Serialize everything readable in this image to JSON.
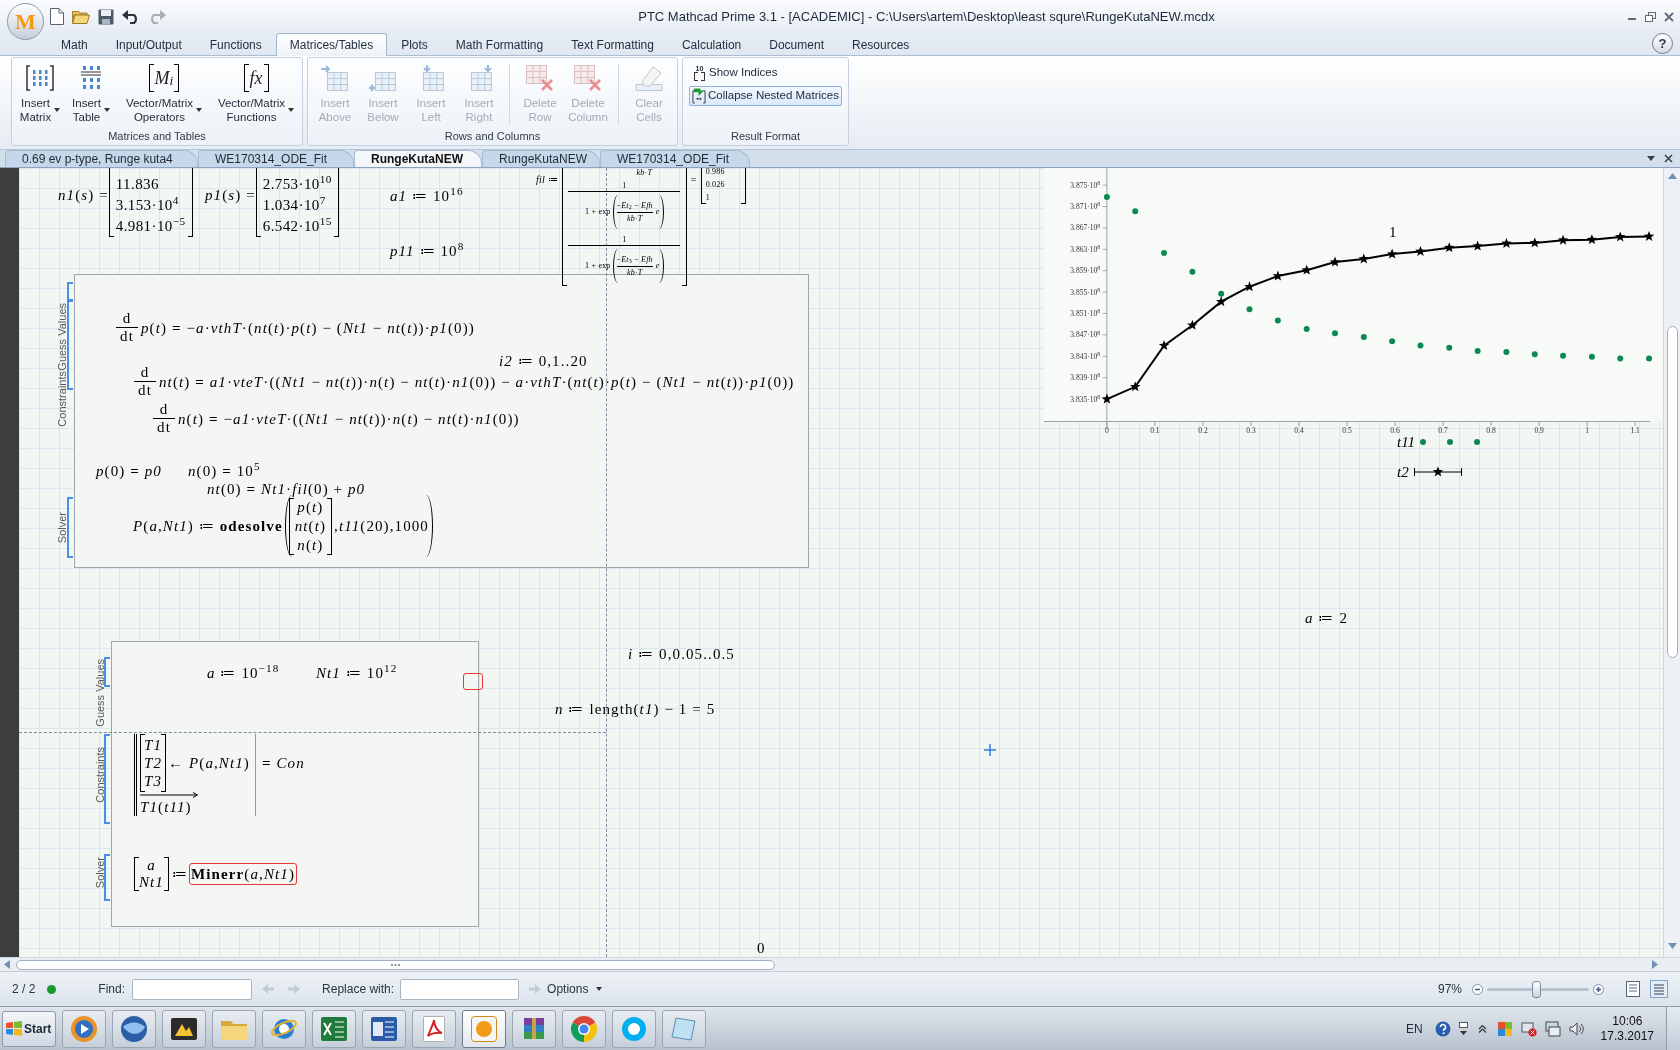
{
  "window": {
    "logo": "M",
    "title": "PTC Mathcad Prime 3.1 - [ACADEMIC] - C:\\Users\\artem\\Desktop\\least squre\\RungeKutaNEW.mcdx"
  },
  "ribbon": {
    "tabs": [
      {
        "label": "Math",
        "selected": false
      },
      {
        "label": "Input/Output",
        "selected": false
      },
      {
        "label": "Functions",
        "selected": false
      },
      {
        "label": "Matrices/Tables",
        "selected": true
      },
      {
        "label": "Plots",
        "selected": false
      },
      {
        "label": "Math Formatting",
        "selected": false
      },
      {
        "label": "Text Formatting",
        "selected": false
      },
      {
        "label": "Calculation",
        "selected": false
      },
      {
        "label": "Document",
        "selected": false
      },
      {
        "label": "Resources",
        "selected": false
      }
    ],
    "help": "?",
    "groups": [
      {
        "title": "Matrices and Tables",
        "sections": [
          [
            {
              "lines": [
                "Insert",
                "Matrix"
              ],
              "dropdown": true,
              "disabled": false
            },
            {
              "lines": [
                "Insert",
                "Table"
              ],
              "dropdown": true,
              "disabled": false
            },
            {
              "lines": [
                "Vector/Matrix",
                "Operators"
              ],
              "glyph": "M$_{i}$",
              "dropdown": true,
              "disabled": false
            },
            {
              "lines": [
                "Vector/Matrix",
                "Functions"
              ],
              "glyph": "fx",
              "dropdown": true,
              "disabled": false
            }
          ]
        ]
      },
      {
        "title": "Rows and Columns",
        "sections": [
          [
            {
              "lines": [
                "Insert",
                "Above"
              ],
              "dropdown": false,
              "disabled": true
            },
            {
              "lines": [
                "Insert",
                "Below"
              ],
              "dropdown": false,
              "disabled": true
            },
            {
              "lines": [
                "Insert",
                "Left"
              ],
              "dropdown": false,
              "disabled": true
            },
            {
              "lines": [
                "Insert",
                "Right"
              ],
              "dropdown": false,
              "disabled": true
            }
          ],
          [
            {
              "lines": [
                "Delete",
                "Row"
              ],
              "dropdown": false,
              "disabled": true
            },
            {
              "lines": [
                "Delete",
                "Column"
              ],
              "dropdown": false,
              "disabled": true
            }
          ],
          [
            {
              "lines": [
                "Clear",
                "Cells"
              ],
              "dropdown": false,
              "disabled": true
            }
          ]
        ]
      },
      {
        "title": "Result Format",
        "toggles": [
          {
            "glyph": "10",
            "label": "Show Indices",
            "selected": false
          },
          {
            "label": "Collapse Nested Matrices",
            "selected": true
          }
        ]
      }
    ]
  },
  "document_tabs": [
    {
      "label": "0.69 ev p-type, Runge kuta4",
      "selected": false
    },
    {
      "label": "WE170314_ODE_Fit",
      "selected": false
    },
    {
      "label": "RungeKutaNEW",
      "selected": true
    },
    {
      "label": "RungeKutaNEW",
      "selected": false
    },
    {
      "label": "WE170314_ODE_Fit",
      "selected": false
    }
  ],
  "worksheet": {
    "regions": [
      {
        "kind": "matrix",
        "lhs": "*n1*(*s*) =",
        "rows": [
          "11.836",
          "3.153·10$^{4}$",
          "4.981·10$^{−5}$"
        ]
      },
      {
        "kind": "matrix",
        "lhs": "*p1*(*s*) =",
        "rows": [
          "2.753·10$^{10}$",
          "1.034·10$^{7}$",
          "6.542·10$^{15}$"
        ]
      },
      {
        "kind": "expr",
        "text": "*a1* ≔ 10$^{16}$"
      },
      {
        "kind": "expr",
        "text": "*p11* ≔ 10$^{8}$"
      },
      {
        "kind": "fraction_matrix",
        "lhs": "*fil* ≔",
        "cut_row": "*kb*·*T*",
        "rows": [
          {
            "numerator": "1",
            "exp": "1 + exp",
            "exp_numerator": "−*Et*$_{2}$ − *Efh*",
            "exp_denominator": "*kb*·*T*",
            "tail": "*e*"
          },
          {
            "numerator": "1",
            "exp": "1 + exp",
            "exp_numerator": "−*Et*$_{3}$ − *Efh*",
            "exp_denominator": "*kb*·*T*",
            "tail": "*e*"
          }
        ],
        "equals": "=",
        "result": [
          "0.986",
          "0.026",
          "1"
        ]
      },
      {
        "kind": "derivative",
        "operator": "d",
        "by": "dt",
        "text": "*p*(*t*) **=** −*a*·*vthT*·(*nt*(*t*)·*p*(*t*) − (*Nt1* − *nt*(*t*))·*p1*(0))"
      },
      {
        "kind": "expr",
        "text": "*i2* ≔ 0,1..20"
      },
      {
        "kind": "derivative",
        "operator": "d",
        "by": "dt",
        "text": "*nt*(*t*) **=** *a1*·*vteT*·((*Nt1* − *nt*(*t*))·*n*(*t*) − *nt*(*t*)·*n1*(0)) − *a*·*vthT*·(*nt*(*t*)·*p*(*t*) − (*Nt1* − *nt*(*t*))·*p1*(0))"
      },
      {
        "kind": "derivative",
        "operator": "d",
        "by": "dt",
        "text": "*n*(*t*) **=** −*a1*·*vteT*·((*Nt1* − *nt*(*t*))·*n*(*t*) − *nt*(*t*)·*n1*(0))"
      },
      {
        "kind": "expr",
        "text": "*p*(0) **=** *p0*"
      },
      {
        "kind": "expr",
        "text": "*n*(0) **=** 10$^{5}$"
      },
      {
        "kind": "expr",
        "text": "*nt*(0) **=** *Nt1*·*fil*(0) + *p0*"
      },
      {
        "kind": "call",
        "lhs": "*P*(*a*,*Nt1*) ≔ **odesolve**",
        "rows": [
          "*p*(*t*)",
          "*nt*(*t*)",
          "*n*(*t*)"
        ],
        "rest": ",*t11*(20),1000"
      },
      {
        "kind": "expr",
        "text": "*a* ≔ 2"
      },
      {
        "kind": "expr",
        "text": "*i* ≔ 0,0.05..0.5"
      },
      {
        "kind": "expr",
        "text": "*n* ≔ length(*t1*) − 1 = 5"
      },
      {
        "kind": "expr",
        "text": "0"
      },
      {
        "kind": "expr",
        "text": "*a* ≔ 10$^{−18}$"
      },
      {
        "kind": "expr",
        "text": "*Nt1* ≔ 10$^{12}$"
      },
      {
        "kind": "placeholder"
      },
      {
        "kind": "program",
        "rows": [
          "*T1*",
          "*T2*",
          "*T3*"
        ],
        "assign": "← *P*(*a*,*Nt1*)",
        "last": "*T1*(*t11*)",
        "result": "**=** *Con*"
      },
      {
        "kind": "solve",
        "rows": [
          "*a*",
          "*Nt1*"
        ],
        "assign": "≔",
        "call": "**Minerr**(*a*,*Nt1*)",
        "error": true
      }
    ],
    "solve_blocks": [
      {
        "labels": [
          "Guess Values",
          "Constraints",
          "Solver"
        ]
      },
      {
        "labels": [
          "Guess Values",
          "Constraints",
          "Solver"
        ]
      }
    ],
    "plot": {
      "chart_data": {
        "type": "line",
        "x": [
          0,
          0.059,
          0.119,
          0.178,
          0.238,
          0.297,
          0.356,
          0.416,
          0.475,
          0.535,
          0.594,
          0.653,
          0.713,
          0.772,
          0.832,
          0.891,
          0.95,
          1.01,
          1.069,
          1.129
        ],
        "series": [
          {
            "name": "t11",
            "color": "#0a8a50",
            "type": "scatter",
            "marker": "circle",
            "values": [
              387280000,
              387010000,
              386230000,
              385880000,
              385470000,
              385180000,
              384970000,
              384810000,
              384730000,
              384660000,
              384580000,
              384500000,
              384460000,
              384400000,
              384380000,
              384340000,
              384310000,
              384290000,
              384260000,
              384260000
            ]
          },
          {
            "name": "t2",
            "color": "#000000",
            "marker": "star",
            "values": [
              383500000,
              383730000,
              384500000,
              384880000,
              385320000,
              385600000,
              385800000,
              385910000,
              386060000,
              386120000,
              386210000,
              386260000,
              386330000,
              386360000,
              386410000,
              386420000,
              386470000,
              386480000,
              386530000,
              386540000
            ]
          }
        ],
        "xlim": [
          -0.131,
          1.131
        ],
        "ylim": [
          383090000,
          387820000
        ],
        "xticks": [
          0,
          0.1,
          0.2,
          0.3,
          0.4,
          0.5,
          0.6,
          0.7,
          0.8,
          0.9,
          1,
          1.1
        ],
        "yticks": [
          {
            "value": 383500000,
            "label": "3.835·10$^{8}$"
          },
          {
            "value": 383900000,
            "label": "3.839·10$^{8}$"
          },
          {
            "value": 384300000,
            "label": "3.843·10$^{8}$"
          },
          {
            "value": 384700000,
            "label": "3.847·10$^{8}$"
          },
          {
            "value": 385100000,
            "label": "3.851·10$^{8}$"
          },
          {
            "value": 385500000,
            "label": "3.855·10$^{8}$"
          },
          {
            "value": 385900000,
            "label": "3.859·10$^{8}$"
          },
          {
            "value": 386300000,
            "label": "3.863·10$^{8}$"
          },
          {
            "value": 386700000,
            "label": "3.867·10$^{8}$"
          },
          {
            "value": 387100000,
            "label": "3.871·10$^{8}$"
          },
          {
            "value": 387500000,
            "label": "3.875·10$^{8}$"
          }
        ],
        "legend": "bottom",
        "annotations": [
          "1"
        ]
      }
    }
  },
  "find_bar": {
    "page_count": "2 / 2",
    "find_label": "Find:",
    "replace_label": "Replace with:",
    "options": "Options",
    "zoom": "97%",
    "zoom_slider": {
      "level": 0.48
    }
  },
  "taskbar": {
    "start": "Start",
    "apps": [
      {
        "selected": false
      },
      {
        "selected": false
      },
      {
        "selected": false
      },
      {
        "selected": false
      },
      {
        "selected": false
      },
      {
        "selected": false
      },
      {
        "selected": false
      },
      {
        "selected": false
      },
      {
        "selected": true
      },
      {
        "selected": false
      },
      {
        "selected": false
      },
      {
        "selected": false
      },
      {
        "selected": false
      }
    ],
    "language": "EN",
    "time": "10:06",
    "date": "17.3.2017"
  }
}
